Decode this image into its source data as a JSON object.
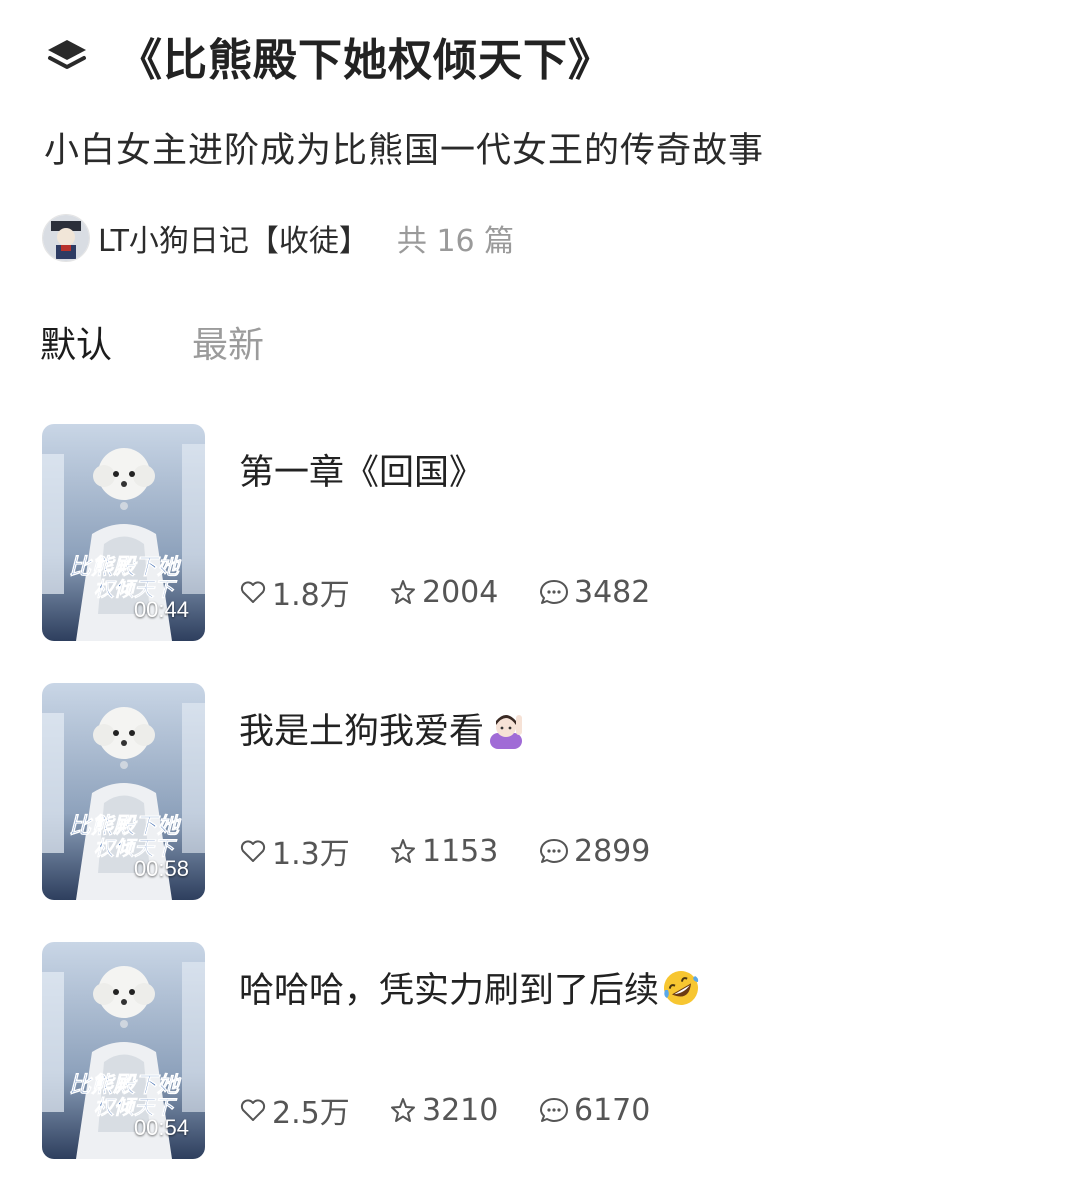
{
  "collection": {
    "title": "《比熊殿下她权倾天下》",
    "subtitle": "小白女主进阶成为比熊国一代女王的传奇故事",
    "author": "LT小狗日记【收徒】",
    "episode_count": "共 16 篇"
  },
  "sort_tabs": [
    {
      "label": "默认",
      "active": true
    },
    {
      "label": "最新",
      "active": false
    }
  ],
  "thumbnail_caption": "“比熊殿下她权倾天下”",
  "episodes": [
    {
      "title": "第一章《回国》",
      "emoji": "",
      "duration": "00:44",
      "likes": "1.8万",
      "favorites": "2004",
      "comments": "3482"
    },
    {
      "title": "我是土狗我爱看",
      "emoji": "person-raising-hand-emoji",
      "duration": "00:58",
      "likes": "1.3万",
      "favorites": "1153",
      "comments": "2899"
    },
    {
      "title": "哈哈哈，凭实力刷到了后续",
      "emoji": "rolling-on-floor-laughing-emoji",
      "duration": "00:54",
      "likes": "2.5万",
      "favorites": "3210",
      "comments": "6170"
    }
  ],
  "colors": {
    "text_primary": "#222222",
    "text_muted": "#9b9b9b",
    "stat_text": "#555555",
    "thumb_bg": "#8fa3bd",
    "thumb_caption": "#2d5da8"
  }
}
